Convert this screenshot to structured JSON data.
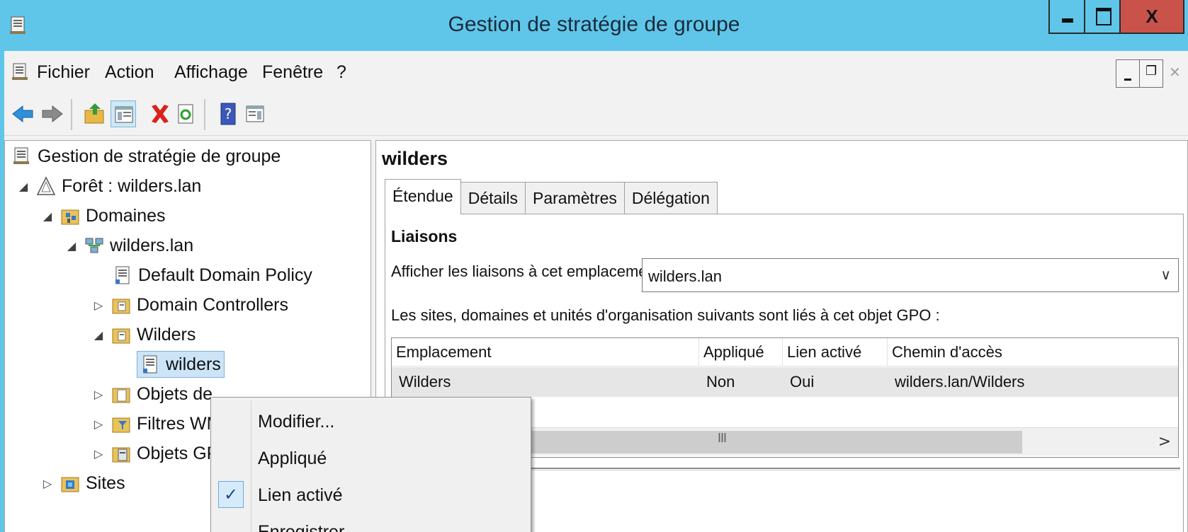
{
  "window": {
    "title": "Gestion de stratégie de groupe",
    "close_label": "X"
  },
  "menubar": {
    "items": [
      "Fichier",
      "Action",
      "Affichage",
      "Fenêtre",
      "?"
    ]
  },
  "toolbar": {
    "buttons": [
      "back-arrow-icon",
      "forward-arrow-icon",
      "up-folder-icon",
      "show-hide-tree-icon",
      "delete-icon",
      "refresh-icon",
      "help-icon",
      "show-action-pane-icon"
    ]
  },
  "tree": {
    "root": "Gestion de stratégie de groupe",
    "forest": "Forêt : wilders.lan",
    "domains": "Domaines",
    "domain": "wilders.lan",
    "default_policy": "Default Domain Policy",
    "domain_controllers": "Domain Controllers",
    "ou": "Wilders",
    "selected_gpo": "wilders",
    "gpo_objects": "Objets de",
    "wmi_filters": "Filtres WM",
    "starter_gpo": "Objets GP",
    "sites": "Sites"
  },
  "details": {
    "gpo_name": "wilders",
    "tabs": [
      "Étendue",
      "Détails",
      "Paramètres",
      "Délégation"
    ],
    "active_tab": "Étendue",
    "links_heading": "Liaisons",
    "show_links_label": "Afficher les liaisons à cet emplacement :",
    "location_value": "wilders.lan",
    "linked_description": "Les sites, domaines et unités d'organisation suivants sont liés à cet objet GPO :",
    "columns": [
      "Emplacement",
      "Appliqué",
      "Lien activé",
      "Chemin d'accès"
    ],
    "rows": [
      {
        "location": "Wilders",
        "enforced": "Non",
        "link_enabled": "Oui",
        "path": "wilders.lan/Wilders"
      }
    ],
    "scroll_grip": "III",
    "scroll_right": ">"
  },
  "context_menu": {
    "items": [
      {
        "label": "Modifier...",
        "checked": false
      },
      {
        "label": "Appliqué",
        "checked": false
      },
      {
        "label": "Lien activé",
        "checked": true
      },
      {
        "label": "Enregistrer",
        "checked": false
      }
    ],
    "check_glyph": "✓"
  },
  "colors": {
    "titlebar": "#5fc6ea",
    "close_button": "#c9534a",
    "selection": "#cce4f7"
  }
}
